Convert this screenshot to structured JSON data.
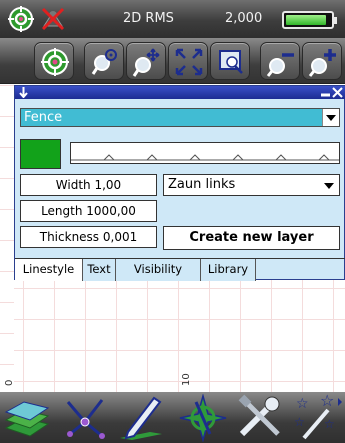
{
  "status_bar": {
    "mode_text": "2D RMS",
    "scale_text": "2,000",
    "battery_level": 0.9,
    "icons": [
      "target-icon",
      "gps-off-icon",
      "battery-icon"
    ]
  },
  "toolbar": {
    "buttons": [
      "target-center",
      "zoom-in-target",
      "pan",
      "zoom-extents",
      "zoom-window",
      "zoom-out",
      "zoom-in"
    ]
  },
  "dialog": {
    "layer_type": "Fence",
    "line_color": "#12a21a",
    "width_label": "Width 1,00",
    "length_label": "Length 1000,00",
    "thickness_label": "Thickness 0,001",
    "side_select": "Zaun links",
    "create_button": "Create new layer",
    "tabs": [
      {
        "label": "Linestyle",
        "active": true
      },
      {
        "label": "Text",
        "active": false
      },
      {
        "label": "Visibility",
        "active": false
      },
      {
        "label": "Library",
        "active": false
      }
    ]
  },
  "canvas": {
    "axis_labels": [
      "0",
      "10"
    ]
  },
  "bottom_bar": {
    "buttons": [
      "layers",
      "network",
      "draw",
      "compass",
      "tools",
      "magic"
    ]
  }
}
